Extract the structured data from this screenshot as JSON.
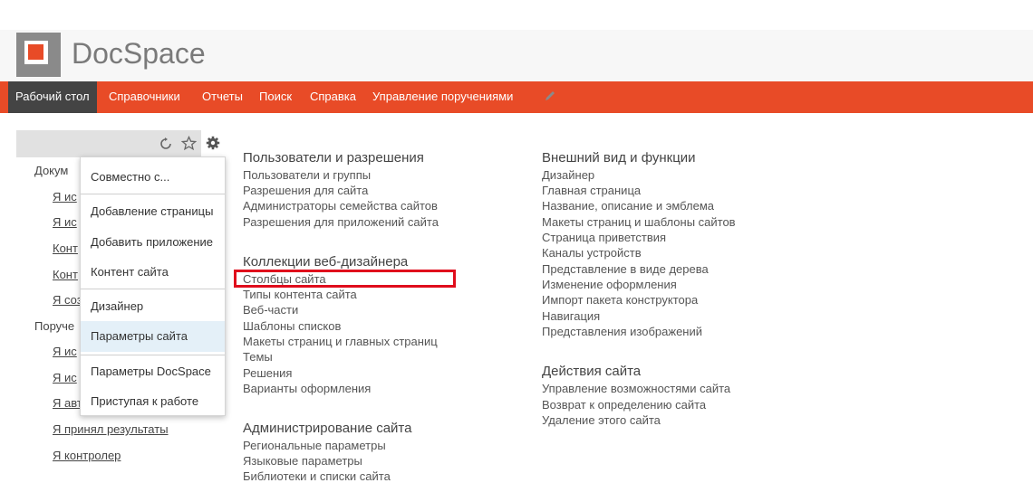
{
  "brand": {
    "name": "DocSpace"
  },
  "nav": {
    "items": [
      "Рабочий стол",
      "Справочники",
      "Отчеты",
      "Поиск",
      "Справка",
      "Управление поручениями"
    ],
    "active_index": 0
  },
  "toolbar": {
    "icons": [
      "sync-icon",
      "star-icon",
      "gear-icon"
    ]
  },
  "left_tree": {
    "group1_label": "Докум",
    "group1_items": [
      "Я ис",
      "Я ис",
      "Конт",
      "Конт",
      "Я соз"
    ],
    "group2_label": "Поруче",
    "group2_items": [
      "Я ис",
      "Я ис",
      "Я авт",
      "Я принял результаты",
      "Я контролер"
    ]
  },
  "settings_menu": {
    "items": [
      "Совместно с...",
      "Добавление страницы",
      "Добавить приложение",
      "Контент сайта",
      "Дизайнер",
      "Параметры сайта",
      "Параметры DocSpace",
      "Приступая к работе"
    ],
    "highlighted": "Параметры сайта"
  },
  "columns": {
    "users": {
      "title": "Пользователи и разрешения",
      "links": [
        "Пользователи и группы",
        "Разрешения для сайта",
        "Администраторы семейства сайтов",
        "Разрешения для приложений сайта"
      ]
    },
    "webdesigner": {
      "title": "Коллекции веб-дизайнера",
      "links": [
        "Столбцы сайта",
        "Типы контента сайта",
        "Веб-части",
        "Шаблоны списков",
        "Макеты страниц и главных страниц",
        "Темы",
        "Решения",
        "Варианты оформления"
      ]
    },
    "admin": {
      "title": "Администрирование сайта",
      "links": [
        "Региональные параметры",
        "Языковые параметры",
        "Библиотеки и списки сайта"
      ]
    },
    "look": {
      "title": "Внешний вид и функции",
      "links": [
        "Дизайнер",
        "Главная страница",
        "Название, описание и эмблема",
        "Макеты страниц и шаблоны сайтов",
        "Страница приветствия",
        "Каналы устройств",
        "Представление в виде дерева",
        "Изменение оформления",
        "Импорт пакета конструктора",
        "Навигация",
        "Представления изображений"
      ]
    },
    "actions": {
      "title": "Действия сайта",
      "links": [
        "Управление возможностями сайта",
        "Возврат к определению сайта",
        "Удаление этого сайта"
      ]
    }
  },
  "colors": {
    "accent": "#e84b27",
    "nav_active": "#444444",
    "highlight_box": "#e00d1c"
  }
}
